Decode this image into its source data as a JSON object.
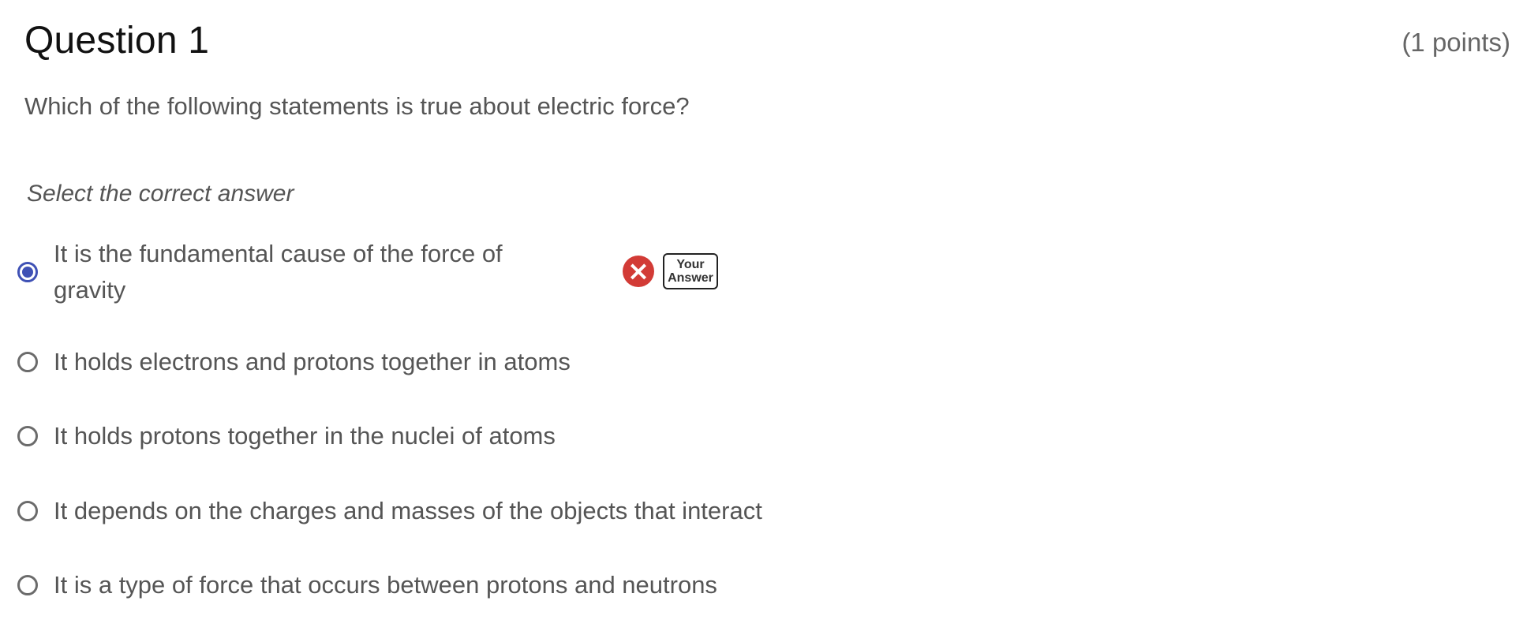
{
  "question": {
    "title": "Question 1",
    "points": "(1 points)",
    "prompt": "Which of the following statements is true about electric force?",
    "instruction": "Select the correct answer"
  },
  "options": [
    {
      "label": "It is the fundamental cause of the force of gravity",
      "selected": true,
      "status_icon": "cross-icon",
      "badge_line1": "Your",
      "badge_line2": "Answer"
    },
    {
      "label": "It holds electrons and protons together in atoms",
      "selected": false
    },
    {
      "label": "It holds protons together in the nuclei of atoms",
      "selected": false
    },
    {
      "label": "It depends on the charges and masses of the objects that interact",
      "selected": false
    },
    {
      "label": "It is a type of force that occurs between protons and neutrons",
      "selected": false
    }
  ],
  "colors": {
    "selected_radio": "#3f51b5",
    "wrong_icon": "#d23b36",
    "text": "#555555",
    "title": "#111111"
  }
}
